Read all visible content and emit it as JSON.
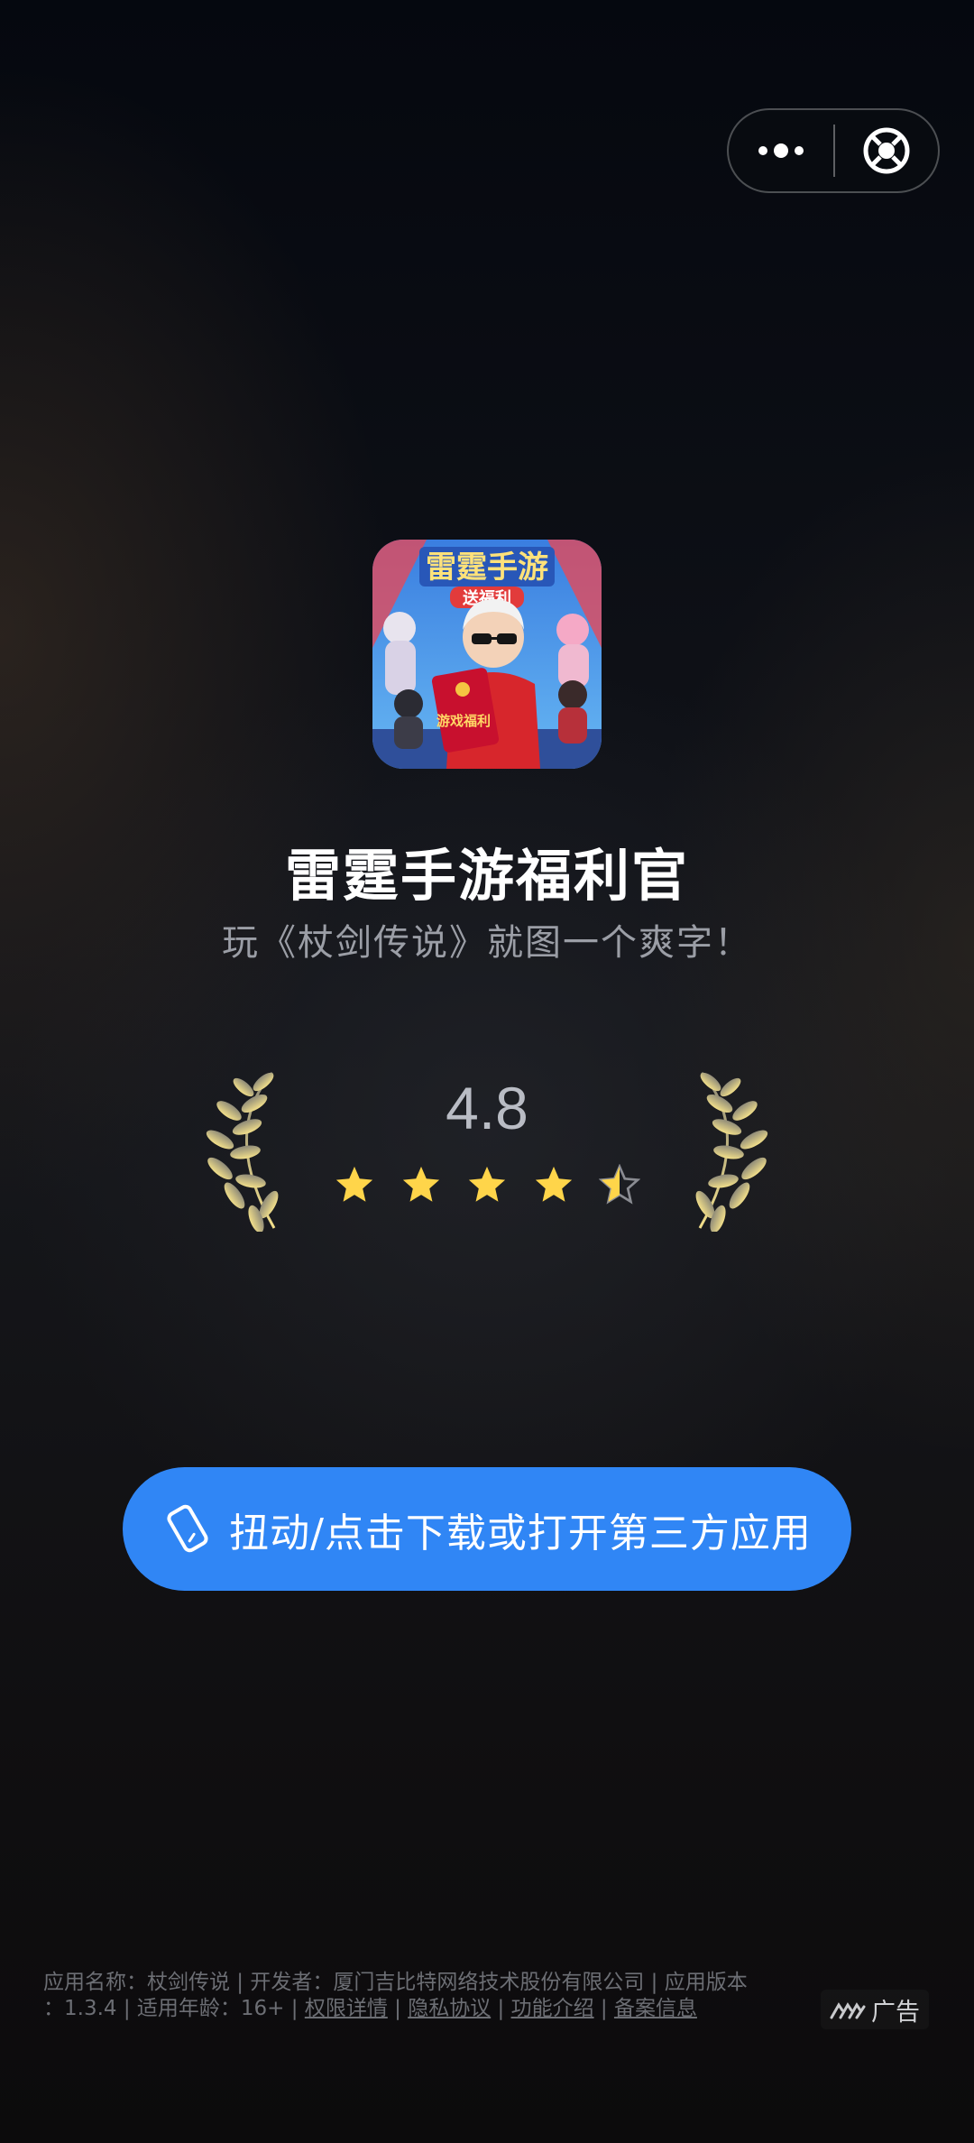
{
  "capsule": {
    "menu_icon": "more-dots-icon",
    "close_icon": "target-close-icon"
  },
  "app": {
    "icon_title": "雷霆手游",
    "icon_banner": "送福利",
    "icon_packet_text": "游戏福利",
    "name": "雷霆手游福利官",
    "slogan": "玩《杖剑传说》就图一个爽字！"
  },
  "rating": {
    "value": "4.8",
    "stars": 4.5,
    "star_color": "#ffd54a"
  },
  "cta": {
    "icon": "phone-tilt-icon",
    "label": "扭动/点击下载或打开第三方应用",
    "color": "#3086f5"
  },
  "footer": {
    "info_prefix": "应用名称：杖剑传说 | 开发者：厦门吉比特网络技术股份有限公司 | 应用版本",
    "info_line2": "：1.3.4 | 适用年龄：16+ | ",
    "link_permissions": "权限详情",
    "sep": " | ",
    "link_privacy": "隐私协议",
    "link_features": "功能介绍",
    "link_filing": "备案信息"
  },
  "ad_badge": {
    "icon": "ad-brand-icon",
    "label": "广告"
  }
}
